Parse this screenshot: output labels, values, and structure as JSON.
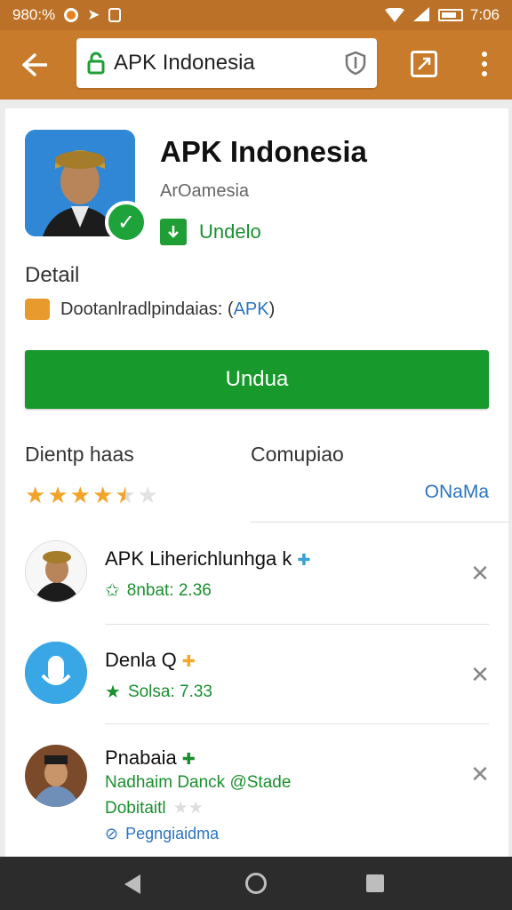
{
  "status_bar": {
    "left_text": "980:%",
    "time": "7:06"
  },
  "app_bar": {
    "url_text": "APK Indonesia",
    "back_icon": "arrow-left-icon",
    "tabs_icon": "tab-switcher-icon",
    "menu_icon": "more-vert-icon"
  },
  "app": {
    "title": "APK Indonesia",
    "subtitle": "ArOamesia",
    "download_label": "Undelo"
  },
  "detail": {
    "heading": "Detail",
    "text": "Dootanlradlpindaias: (",
    "apk_label": "APK",
    "close_paren": ")"
  },
  "primary_button": {
    "label": "Undua"
  },
  "rating": {
    "heading_left": "Dientp haas",
    "heading_right": "Comupiao",
    "stars_value": 4.5,
    "stars_max": 5,
    "more_label": "ONaMa"
  },
  "list": [
    {
      "title": "APK Liherichlunhga k",
      "sub": "8nbat: 2.36"
    },
    {
      "title": "Denla Q",
      "sub": "Solsa: 7.33"
    },
    {
      "title": "Pnabaia",
      "sub": "Nadhaim Danck @Stade",
      "sub2": "Dobitaitl",
      "sub3": "Pegngiaidma"
    }
  ],
  "colors": {
    "status_bar": "#bb7127",
    "app_bar": "#c97b2c",
    "primary_green": "#179a2b",
    "link_blue": "#2a74c4",
    "star": "#f2a42a"
  }
}
